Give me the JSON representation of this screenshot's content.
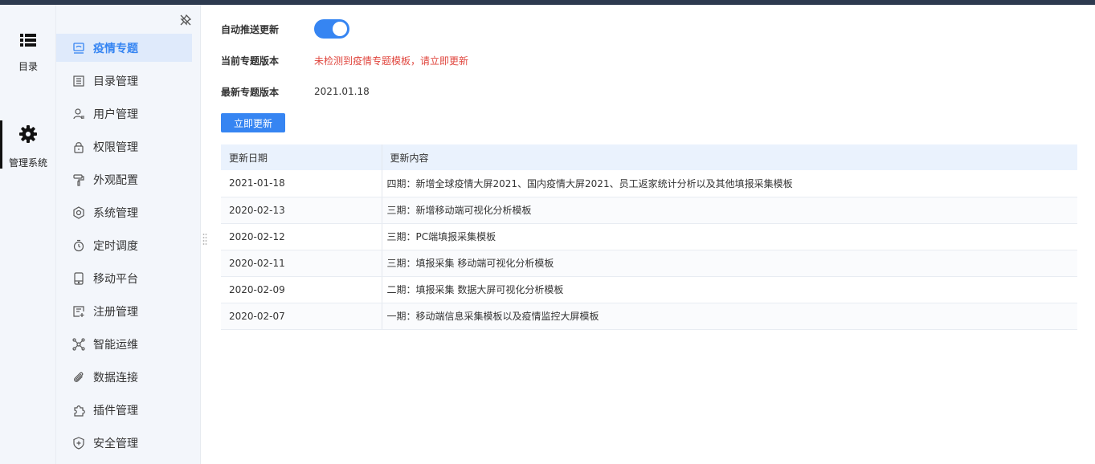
{
  "rail": {
    "items": [
      {
        "label": "目录",
        "icon": "list-icon"
      },
      {
        "label": "管理系统",
        "icon": "gear-icon"
      }
    ]
  },
  "sidebar": {
    "items": [
      {
        "label": "疫情专题",
        "icon": "monitor-icon",
        "active": true
      },
      {
        "label": "目录管理",
        "icon": "catalog-icon"
      },
      {
        "label": "用户管理",
        "icon": "user-icon"
      },
      {
        "label": "权限管理",
        "icon": "lock-icon"
      },
      {
        "label": "外观配置",
        "icon": "paint-roller-icon"
      },
      {
        "label": "系统管理",
        "icon": "settings-icon"
      },
      {
        "label": "定时调度",
        "icon": "timer-icon"
      },
      {
        "label": "移动平台",
        "icon": "mobile-icon"
      },
      {
        "label": "注册管理",
        "icon": "register-icon"
      },
      {
        "label": "智能运维",
        "icon": "network-icon"
      },
      {
        "label": "数据连接",
        "icon": "paperclip-icon"
      },
      {
        "label": "插件管理",
        "icon": "puzzle-icon"
      },
      {
        "label": "安全管理",
        "icon": "shield-icon"
      }
    ]
  },
  "settings": {
    "auto_push_label": "自动推送更新",
    "auto_push_on": true,
    "current_version_label": "当前专题版本",
    "current_version_value": "未检测到疫情专题模板，请立即更新",
    "latest_version_label": "最新专题版本",
    "latest_version_value": "2021.01.18",
    "update_button": "立即更新"
  },
  "history": {
    "headers": [
      "更新日期",
      "更新内容"
    ],
    "rows": [
      {
        "date": "2021-01-18",
        "content": "四期：新增全球疫情大屏2021、国内疫情大屏2021、员工返家统计分析以及其他填报采集模板"
      },
      {
        "date": "2020-02-13",
        "content": "三期：新增移动端可视化分析模板"
      },
      {
        "date": "2020-02-12",
        "content": "三期：PC端填报采集模板"
      },
      {
        "date": "2020-02-11",
        "content": "三期：填报采集 移动端可视化分析模板"
      },
      {
        "date": "2020-02-09",
        "content": "二期：填报采集 数据大屏可视化分析模板"
      },
      {
        "date": "2020-02-07",
        "content": "一期：移动端信息采集模板以及疫情监控大屏模板"
      }
    ]
  },
  "colors": {
    "accent": "#3685f2",
    "warning": "#e0463e",
    "topbar": "#2d3a4f"
  }
}
